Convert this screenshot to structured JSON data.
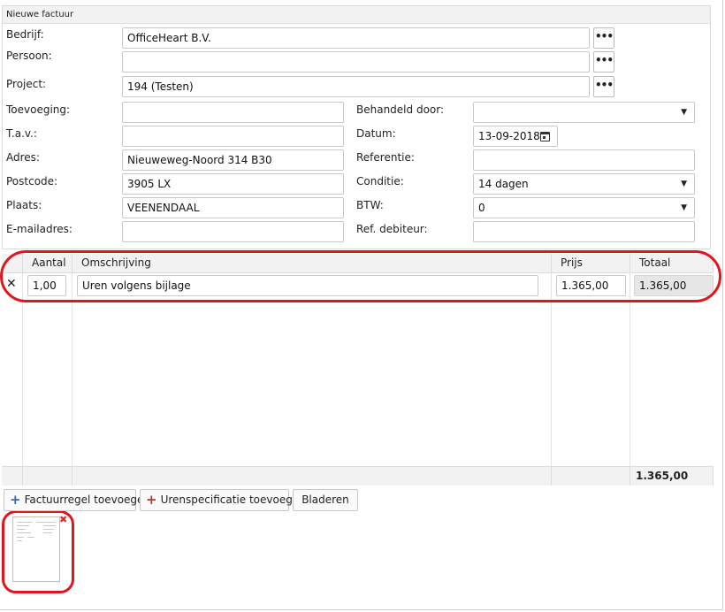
{
  "panel": {
    "title": "Nieuwe factuur"
  },
  "form": {
    "bedrijf": {
      "label": "Bedrijf:",
      "value": "OfficeHeart B.V."
    },
    "persoon": {
      "label": "Persoon:",
      "value": ""
    },
    "project": {
      "label": "Project:",
      "value": "194 (Testen)"
    },
    "toevoeging": {
      "label": "Toevoeging:",
      "value": ""
    },
    "tav": {
      "label": "T.a.v.:",
      "value": ""
    },
    "adres": {
      "label": "Adres:",
      "value": "Nieuweweg-Noord 314 B30"
    },
    "postcode": {
      "label": "Postcode:",
      "value": "3905 LX"
    },
    "plaats": {
      "label": "Plaats:",
      "value": "VEENENDAAL"
    },
    "email": {
      "label": "E-mailadres:",
      "value": ""
    },
    "behandeld_door": {
      "label": "Behandeld door:",
      "value": ""
    },
    "datum": {
      "label": "Datum:",
      "value": "13-09-2018"
    },
    "referentie": {
      "label": "Referentie:",
      "value": ""
    },
    "conditie": {
      "label": "Conditie:",
      "value": "14 dagen"
    },
    "btw": {
      "label": "BTW:",
      "value": "0"
    },
    "ref_debiteur": {
      "label": "Ref. debiteur:",
      "value": ""
    },
    "browse_label": "•••",
    "dropdown_arrow": "▼"
  },
  "table": {
    "headers": {
      "aantal": "Aantal",
      "omschrijving": "Omschrijving",
      "prijs": "Prijs",
      "totaal": "Totaal"
    },
    "rows": [
      {
        "delete": "✕",
        "aantal": "1,00",
        "omschrijving": "Uren volgens bijlage",
        "prijs": "1.365,00",
        "totaal": "1.365,00"
      }
    ],
    "footer_total": "1.365,00"
  },
  "actions": {
    "factuurregel": "Factuurregel toevoegen",
    "urenspecificatie": "Urenspecificatie toevoegen",
    "bladeren": "Bladeren",
    "plus_icon": "+"
  },
  "attachment": {
    "remove_icon": "✖"
  },
  "colors": {
    "highlight": "#e0151e",
    "add_blue": "#2a6fb5",
    "add_red": "#c0392b"
  }
}
